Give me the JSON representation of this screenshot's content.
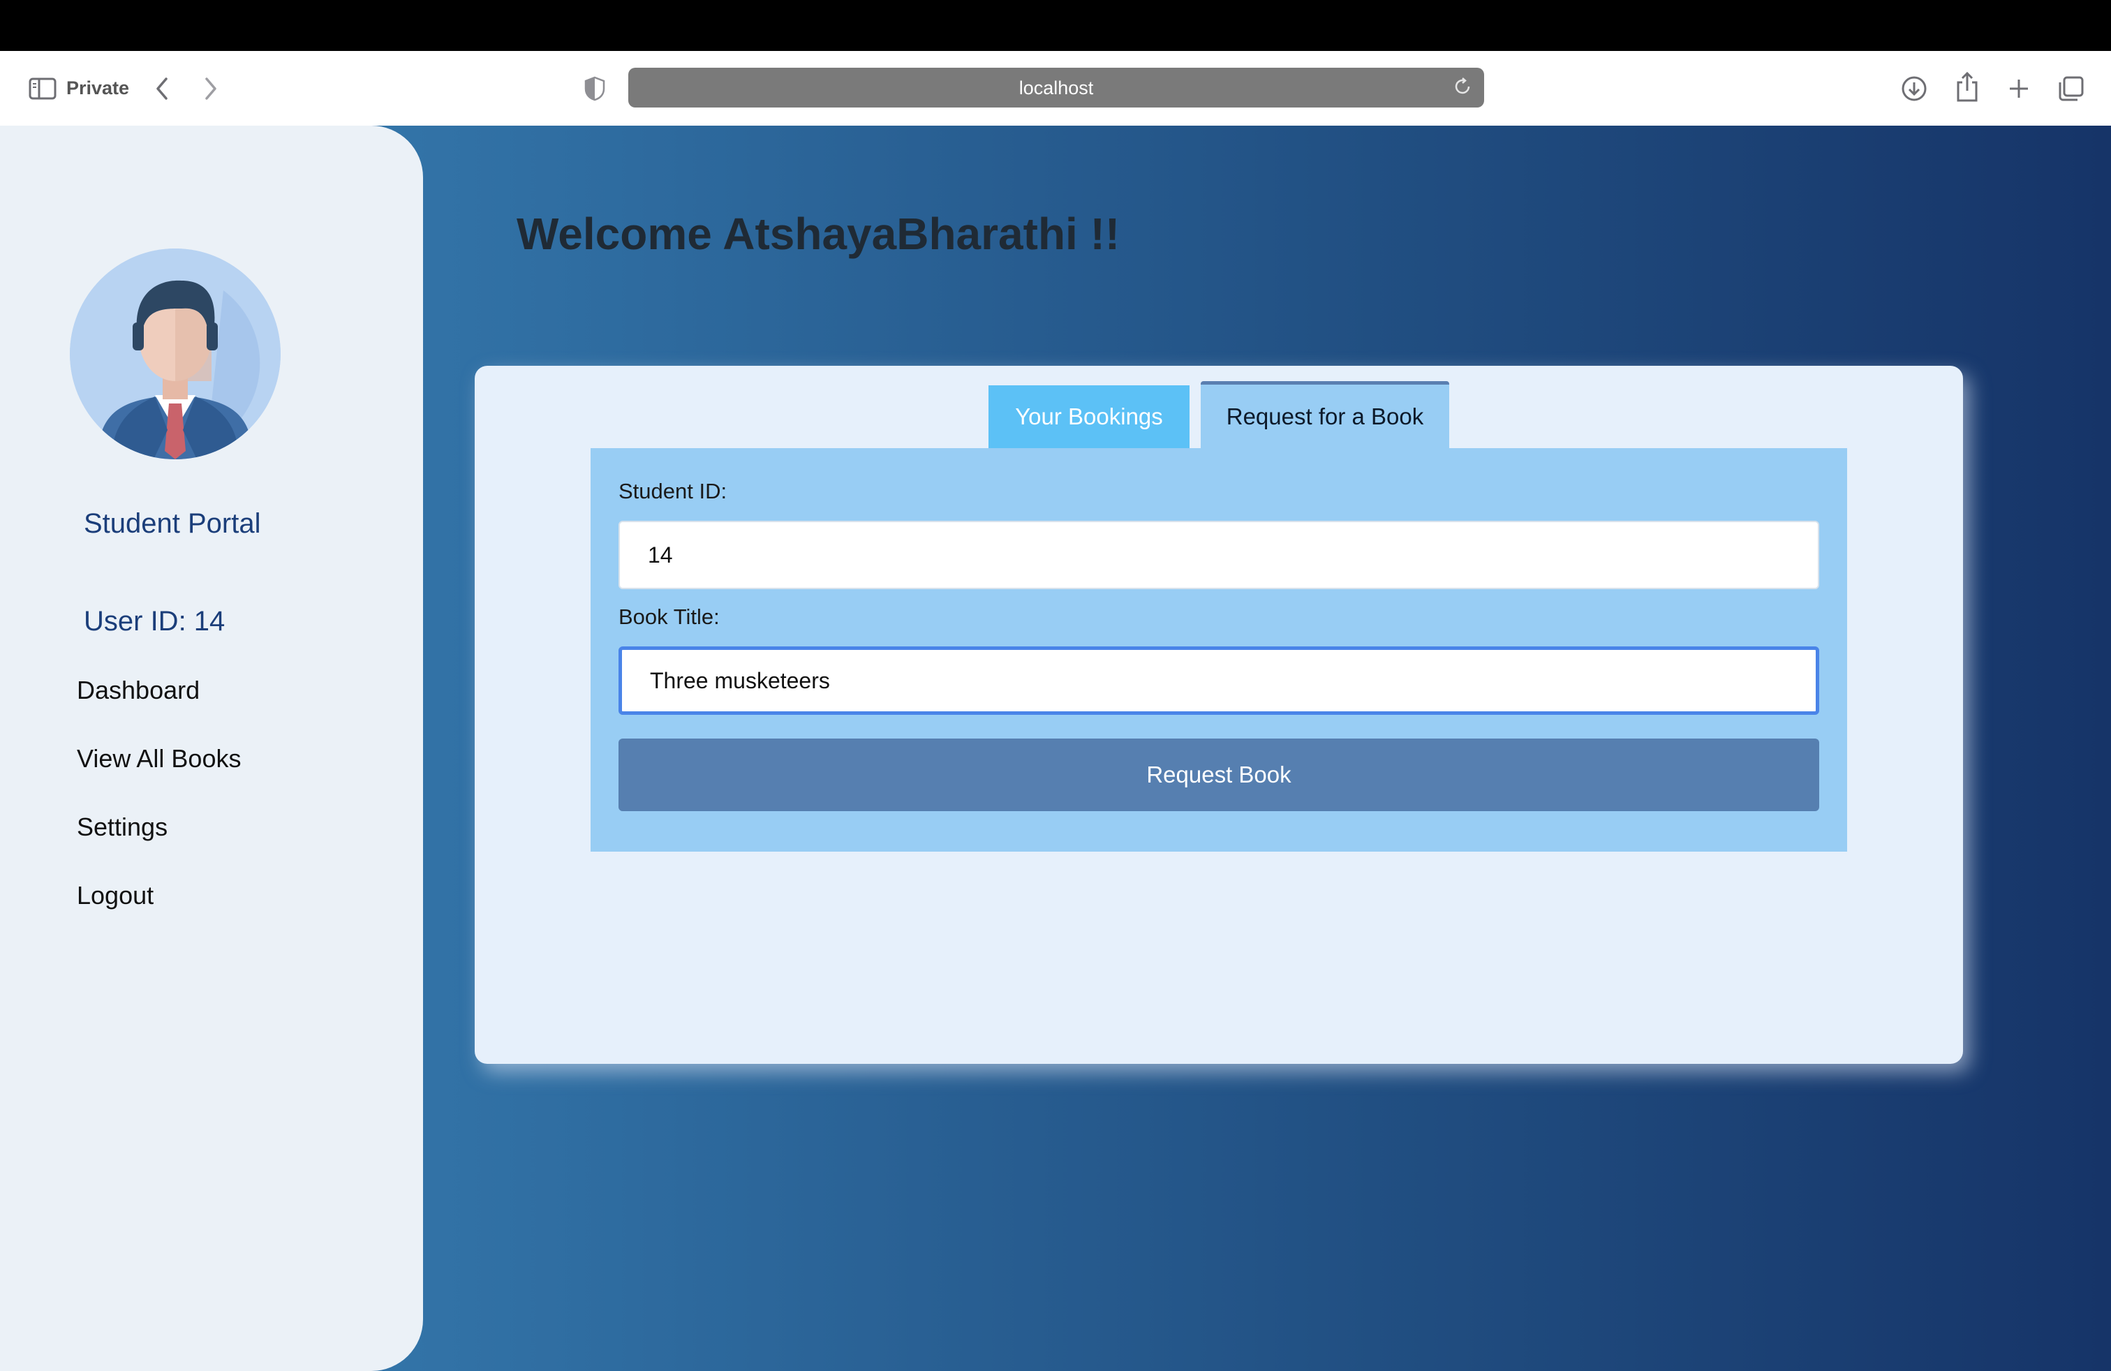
{
  "browser": {
    "mode_label": "Private",
    "url": "localhost"
  },
  "sidebar": {
    "portal_title": "Student Portal",
    "user_id_label": "User ID: 14",
    "items": [
      {
        "label": "Dashboard"
      },
      {
        "label": "View All Books"
      },
      {
        "label": "Settings"
      },
      {
        "label": "Logout"
      }
    ]
  },
  "main": {
    "welcome": "Welcome AtshayaBharathi !!",
    "tabs": [
      {
        "label": "Your Bookings",
        "active": false
      },
      {
        "label": "Request for a Book",
        "active": true
      }
    ],
    "form": {
      "student_id_label": "Student ID:",
      "student_id_value": "14",
      "book_title_label": "Book Title:",
      "book_title_value": "Three musketeers",
      "submit_label": "Request Book"
    }
  },
  "colors": {
    "accent": "#567fb0",
    "tab_inactive": "#5cc1f6",
    "panel": "#98cdf4",
    "sidebar_text": "#1b3e7a"
  },
  "icons": [
    "sidebar-toggle-icon",
    "chevron-left-icon",
    "chevron-right-icon",
    "shield-icon",
    "reload-icon",
    "download-icon",
    "share-icon",
    "plus-icon",
    "tabs-overview-icon",
    "user-avatar-icon"
  ]
}
